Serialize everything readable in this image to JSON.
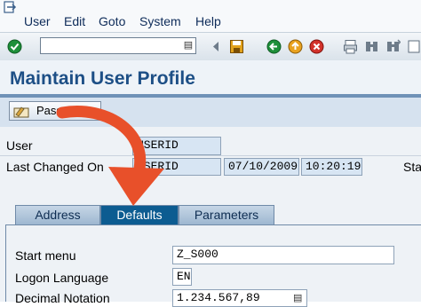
{
  "menubar": {
    "items": [
      "User",
      "Edit",
      "Goto",
      "System",
      "Help"
    ]
  },
  "toolbar": {
    "command_value": "",
    "icons": [
      "enter-icon",
      "save-icon",
      "back-icon",
      "exit-icon",
      "cancel-icon",
      "print-icon",
      "find-icon",
      "find-next-icon"
    ]
  },
  "title": "Maintain User Profile",
  "app_toolbar": {
    "password_button": "Password"
  },
  "header": {
    "user_label": "User",
    "user_value": "USERID",
    "last_changed_label": "Last Changed On",
    "last_changed_by": "USERID",
    "last_changed_date": "07/10/2009",
    "last_changed_time": "10:20:19",
    "status_label": "Sta"
  },
  "tabs": [
    {
      "label": "Address",
      "active": false
    },
    {
      "label": "Defaults",
      "active": true
    },
    {
      "label": "Parameters",
      "active": false
    }
  ],
  "defaults": {
    "start_menu_label": "Start menu",
    "start_menu_value": "Z_S000",
    "logon_language_label": "Logon Language",
    "logon_language_value": "EN",
    "decimal_notation_label": "Decimal Notation",
    "decimal_notation_value": "1.234.567,89"
  },
  "colors": {
    "title": "#1d4f86",
    "active_tab": "#0c5c91",
    "arrow": "#e8502a"
  }
}
